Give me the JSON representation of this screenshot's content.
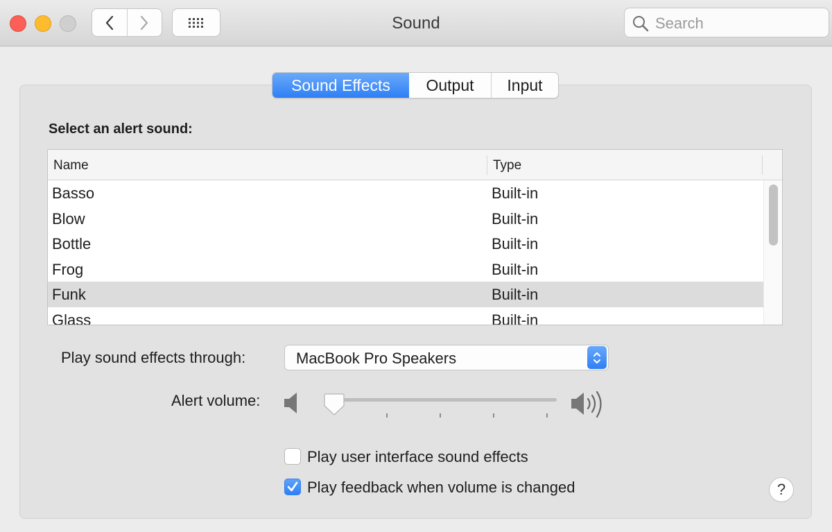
{
  "window": {
    "title": "Sound",
    "search_placeholder": "Search"
  },
  "toolbar": {
    "back_icon": "chevron-left-icon",
    "forward_icon": "chevron-right-icon",
    "show_all_icon": "grid-icon"
  },
  "tabs": [
    {
      "label": "Sound Effects",
      "selected": true
    },
    {
      "label": "Output",
      "selected": false
    },
    {
      "label": "Input",
      "selected": false
    }
  ],
  "alerts": {
    "heading": "Select an alert sound:",
    "columns": [
      "Name",
      "Type"
    ],
    "rows": [
      {
        "name": "Basso",
        "type": "Built-in"
      },
      {
        "name": "Blow",
        "type": "Built-in"
      },
      {
        "name": "Bottle",
        "type": "Built-in"
      },
      {
        "name": "Frog",
        "type": "Built-in"
      },
      {
        "name": "Funk",
        "type": "Built-in",
        "selected": true
      },
      {
        "name": "Glass",
        "type": "Built-in"
      }
    ]
  },
  "output_device": {
    "label": "Play sound effects through:",
    "value": "MacBook Pro Speakers"
  },
  "alert_volume": {
    "label": "Alert volume:",
    "value_fraction": 0.0
  },
  "checkboxes": [
    {
      "label": "Play user interface sound effects",
      "checked": false
    },
    {
      "label": "Play feedback when volume is changed",
      "checked": true
    }
  ],
  "help_label": "?",
  "colors": {
    "accent": "#2f80f4",
    "selection_row": "#dcdcdc"
  }
}
